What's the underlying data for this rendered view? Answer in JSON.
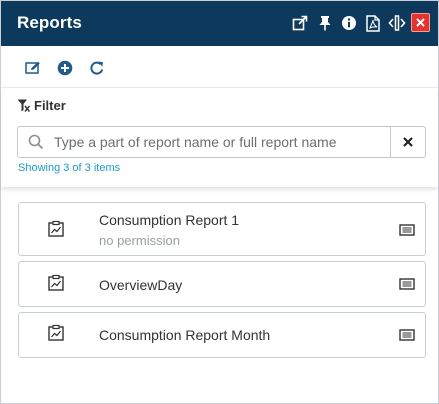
{
  "header": {
    "title": "Reports",
    "accent_color": "#0d3a5c",
    "close_color": "#e5322d",
    "icons": [
      "external-link-icon",
      "pin-icon",
      "info-icon",
      "pdf-icon",
      "resize-icon",
      "close-icon"
    ]
  },
  "toolbar": {
    "icons": [
      "edit-icon",
      "add-icon",
      "refresh-icon"
    ]
  },
  "filter": {
    "label": "Filter",
    "search_placeholder": "Type a part of report name or full report name",
    "search_value": "",
    "count_text": "Showing 3 of 3 items",
    "count_color": "#1a9dc8"
  },
  "reports": [
    {
      "name": "Consumption Report 1",
      "subtitle": "no permission"
    },
    {
      "name": "OverviewDay",
      "subtitle": ""
    },
    {
      "name": "Consumption Report Month",
      "subtitle": ""
    }
  ]
}
